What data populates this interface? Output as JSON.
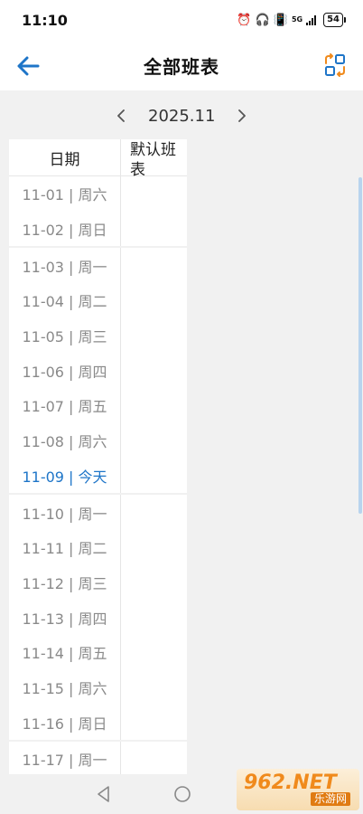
{
  "status_bar": {
    "time": "11:10",
    "network": "5G",
    "battery": "54"
  },
  "header": {
    "title": "全部班表",
    "back_icon": "arrow-left-icon",
    "switch_icon": "switch-view-icon",
    "accent_color": "#1e75c8"
  },
  "month_nav": {
    "label": "2025.11",
    "prev_icon": "chevron-left-icon",
    "next_icon": "chevron-right-icon"
  },
  "table": {
    "col_date": "日期",
    "col_schedule": "默认班表",
    "weeks": [
      {
        "days": [
          {
            "label": "11-01 | 周六"
          },
          {
            "label": "11-02 | 周日"
          }
        ]
      },
      {
        "days": [
          {
            "label": "11-03 | 周一"
          },
          {
            "label": "11-04 | 周二"
          },
          {
            "label": "11-05 | 周三"
          },
          {
            "label": "11-06 | 周四"
          },
          {
            "label": "11-07 | 周五"
          },
          {
            "label": "11-08 | 周六"
          },
          {
            "label": "11-09 | 今天",
            "today": true
          }
        ]
      },
      {
        "days": [
          {
            "label": "11-10 | 周一"
          },
          {
            "label": "11-11 | 周二"
          },
          {
            "label": "11-12 | 周三"
          },
          {
            "label": "11-13 | 周四"
          },
          {
            "label": "11-14 | 周五"
          },
          {
            "label": "11-15 | 周六"
          },
          {
            "label": "11-16 | 周日"
          }
        ]
      },
      {
        "days": [
          {
            "label": "11-17 | 周一"
          }
        ]
      }
    ]
  },
  "watermark": {
    "main": "962.NET",
    "sub": "乐游网"
  }
}
